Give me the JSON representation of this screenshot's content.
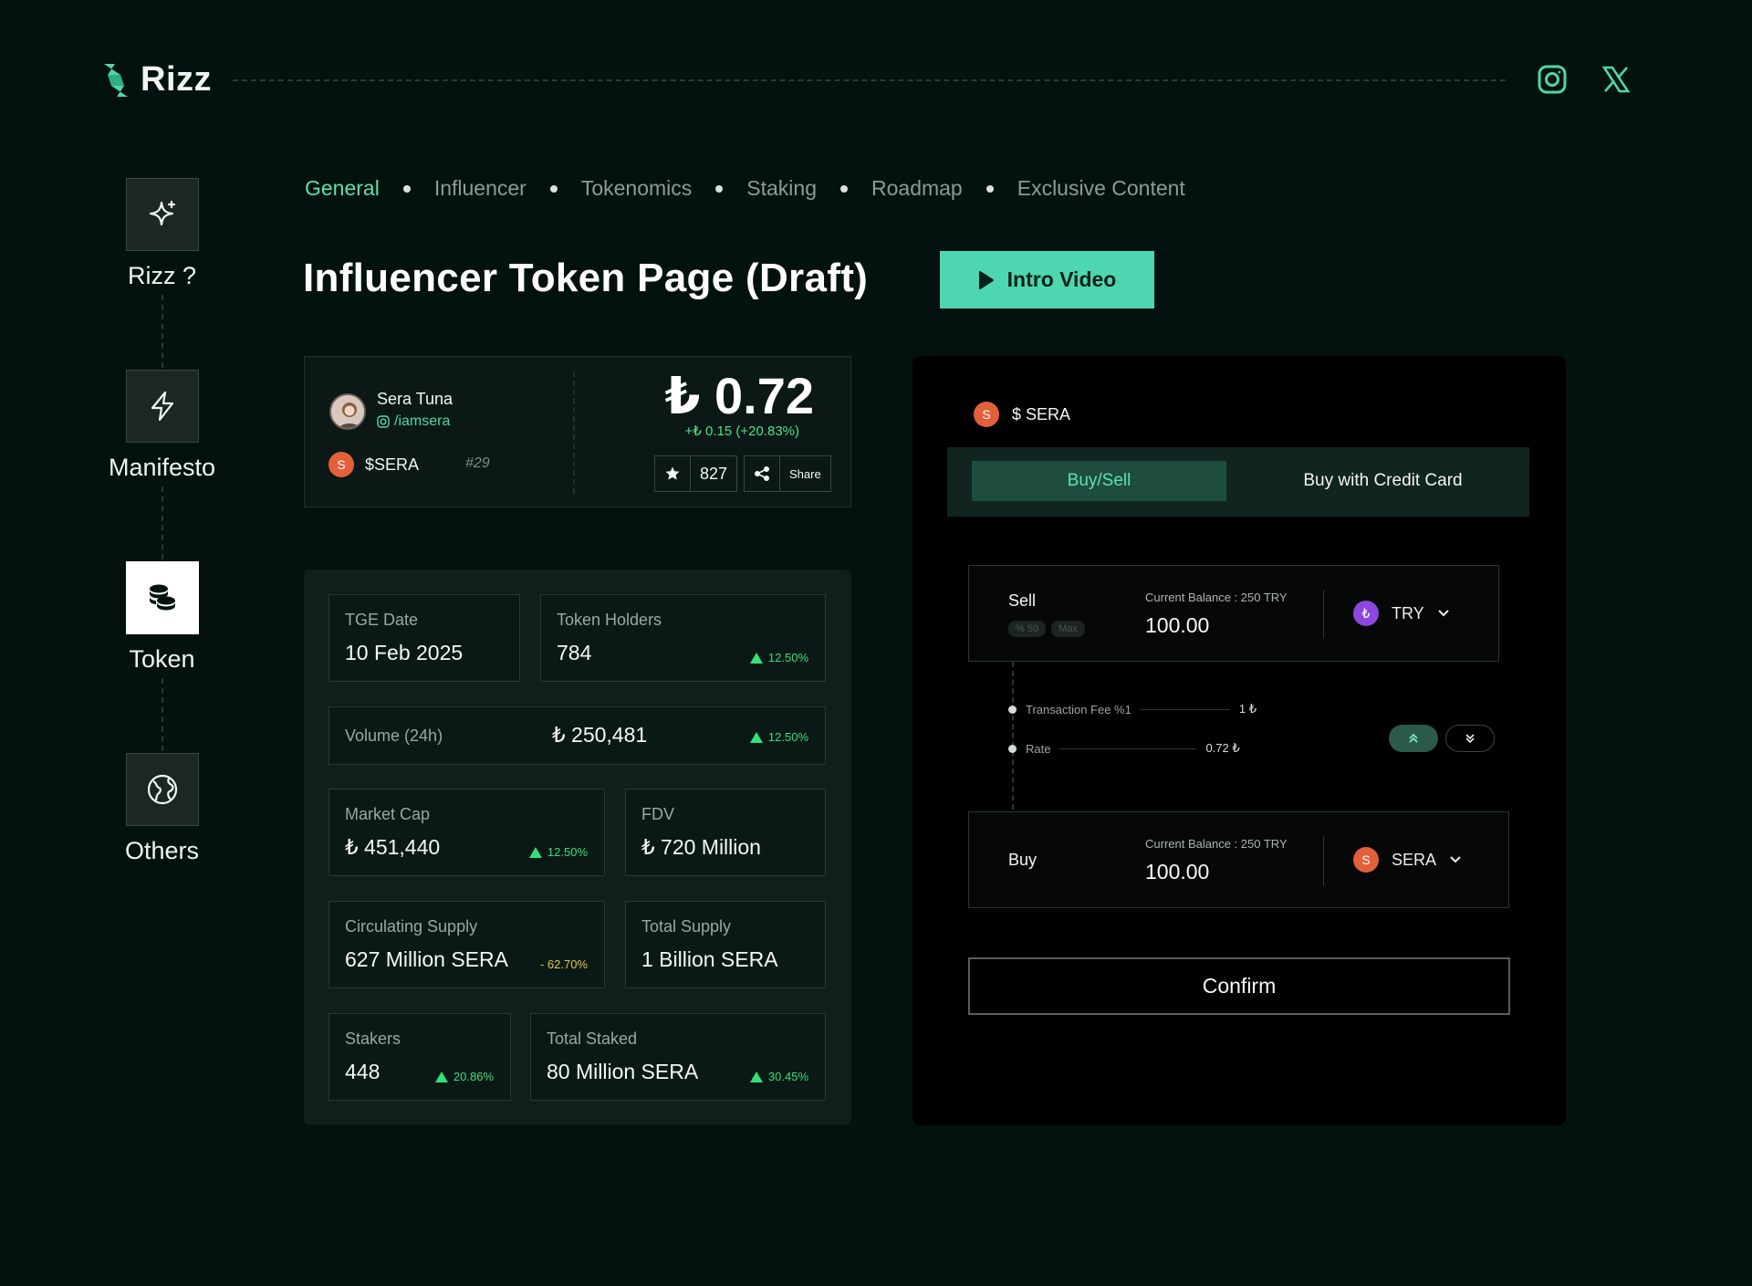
{
  "brand": {
    "name": "Rizz"
  },
  "social": {
    "instagram": "instagram-icon",
    "x": "x-icon"
  },
  "sidenav": {
    "items": [
      {
        "label": "Rizz ?",
        "icon": "sparkle-icon"
      },
      {
        "label": "Manifesto",
        "icon": "lightning-icon"
      },
      {
        "label": "Token",
        "icon": "coins-icon",
        "active": true
      },
      {
        "label": "Others",
        "icon": "globe-icon"
      }
    ]
  },
  "tabs": [
    "General",
    "Influencer",
    "Tokenomics",
    "Staking",
    "Roadmap",
    "Exclusive Content"
  ],
  "page": {
    "title": "Influencer Token Page (Draft)",
    "intro_button": "Intro Video"
  },
  "profile": {
    "name": "Sera Tuna",
    "handle": "/iamsera",
    "token": "$SERA",
    "coin_letter": "S",
    "rank": "#29",
    "price": "₺ 0.72",
    "change": "+₺ 0.15 (+20.83%)",
    "favorites": "827",
    "share_label": "Share"
  },
  "stats": {
    "tge": {
      "label": "TGE Date",
      "value": "10 Feb 2025"
    },
    "holders": {
      "label": "Token Holders",
      "value": "784",
      "change": "12.50%"
    },
    "volume": {
      "label": "Volume (24h)",
      "value": "₺ 250,481",
      "change": "12.50%"
    },
    "market_cap": {
      "label": "Market Cap",
      "value": "₺ 451,440",
      "change": "12.50%"
    },
    "fdv": {
      "label": "FDV",
      "value": "₺ 720 Million"
    },
    "circulating": {
      "label": "Circulating Supply",
      "value": "627 Million SERA",
      "change": "- 62.70%"
    },
    "total_supply": {
      "label": "Total Supply",
      "value": "1 Billion SERA"
    },
    "stakers": {
      "label": "Stakers",
      "value": "448",
      "change": "20.86%"
    },
    "total_staked": {
      "label": "Total Staked",
      "value": "80 Million SERA",
      "change": "30.45%"
    }
  },
  "trade": {
    "token_label": "$ SERA",
    "coin_letter": "S",
    "tab_buy_sell": "Buy/Sell",
    "tab_credit": "Buy with Credit Card",
    "sell": {
      "side": "Sell",
      "chip_50": "% 50",
      "chip_max": "Max",
      "balance_label": "Current Balance : 250 TRY",
      "amount": "100.00",
      "currency": "TRY",
      "currency_symbol": "₺"
    },
    "fee": {
      "label": "Transaction Fee %1",
      "value": "1 ₺"
    },
    "rate": {
      "label": "Rate",
      "value": "0.72 ₺"
    },
    "buy": {
      "side": "Buy",
      "balance_label": "Current Balance : 250 TRY",
      "amount": "100.00",
      "currency": "SERA",
      "currency_symbol": "S"
    },
    "confirm_label": "Confirm"
  }
}
